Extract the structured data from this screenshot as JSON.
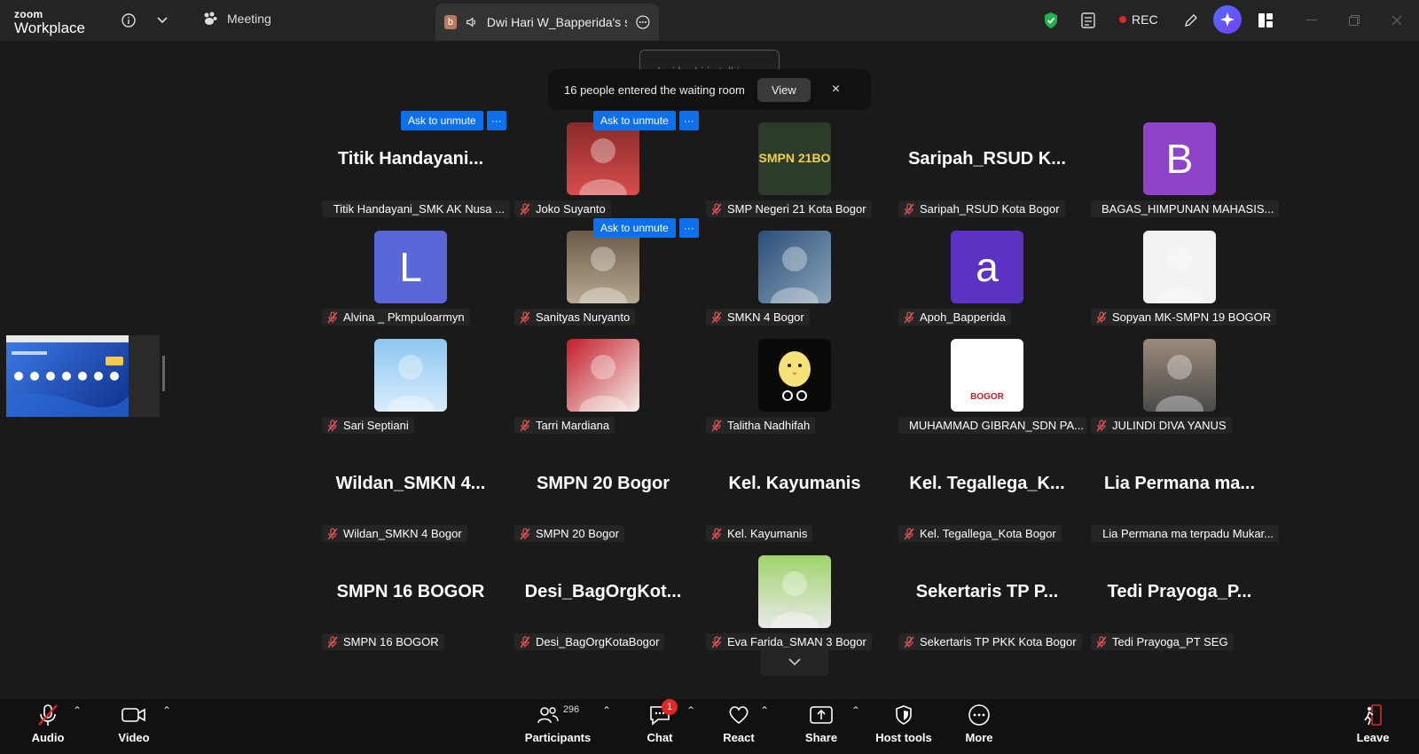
{
  "titlebar": {
    "logo_top": "zoom",
    "logo_bottom": "Workplace",
    "meeting_label": "Meeting",
    "share_tab_badge": "b",
    "share_tab_label": "Dwi Hari W_Bapperida's scre",
    "rec_label": "REC"
  },
  "toasts": {
    "talking": "lusi badri is talking...",
    "waiting_text": "16 people entered the waiting room",
    "waiting_view": "View",
    "waiting_close": "×"
  },
  "ask_unmute": "Ask to unmute",
  "more_glyph": "···",
  "participants": [
    {
      "bigname": "Titik  Handayani...",
      "label": "Titik Handayani_SMK AK Nusa ..."
    },
    {
      "label": "Joko Suyanto"
    },
    {
      "label": "SMP Negeri 21 Kota Bogor",
      "avatar_text": "SMPN 21BO"
    },
    {
      "bigname": "Saripah_RSUD  K...",
      "label": "Saripah_RSUD Kota Bogor"
    },
    {
      "letter": "B",
      "label": "BAGAS_HIMPUNAN MAHASIS..."
    },
    {
      "letter": "L",
      "label": "Alvina _ Pkmpuloarmyn"
    },
    {
      "label": "Sanityas Nuryanto"
    },
    {
      "label": "SMKN 4 Bogor"
    },
    {
      "letter": "a",
      "label": "Apoh_Bapperida"
    },
    {
      "label": "Sopyan MK-SMPN 19 BOGOR"
    },
    {
      "label": "Sari Septiani"
    },
    {
      "label": "Tarri Mardiana"
    },
    {
      "label": "Talitha Nadhifah"
    },
    {
      "label": "MUHAMMAD GIBRAN_SDN PA...",
      "avatar_text": "BOGOR"
    },
    {
      "label": "JULINDI DIVA YANUS"
    },
    {
      "bigname": "Wildan_SMKN  4...",
      "label": "Wildan_SMKN 4 Bogor"
    },
    {
      "bigname": "SMPN 20 Bogor",
      "label": "SMPN 20 Bogor"
    },
    {
      "bigname": "Kel. Kayumanis",
      "label": "Kel. Kayumanis"
    },
    {
      "bigname": "Kel.  Tegallega_K...",
      "label": "Kel. Tegallega_Kota Bogor"
    },
    {
      "bigname": "Lia  Permana  ma...",
      "label": "Lia Permana ma terpadu Mukar..."
    },
    {
      "bigname": "SMPN 16 BOGOR",
      "label": "SMPN 16 BOGOR"
    },
    {
      "bigname": "Desi_BagOrgKot...",
      "label": "Desi_BagOrgKotaBogor"
    },
    {
      "label": "Eva Farida_SMAN 3 Bogor"
    },
    {
      "bigname": "Sekertaris  TP  P...",
      "label": "Sekertaris TP PKK Kota Bogor"
    },
    {
      "bigname": "Tedi  Prayoga_P...",
      "label": "Tedi Prayoga_PT SEG"
    }
  ],
  "toolbar": {
    "audio": "Audio",
    "video": "Video",
    "participants": "Participants",
    "participants_count": "296",
    "chat": "Chat",
    "chat_badge": "1",
    "react": "React",
    "share": "Share",
    "host_tools": "Host tools",
    "more": "More",
    "leave": "Leave"
  },
  "colors": {
    "accent_blue": "#0e71eb",
    "rec_red": "#e02828",
    "avatar_b": "#8e44c9",
    "avatar_l": "#5a67d8",
    "avatar_a": "#5b32c4"
  }
}
